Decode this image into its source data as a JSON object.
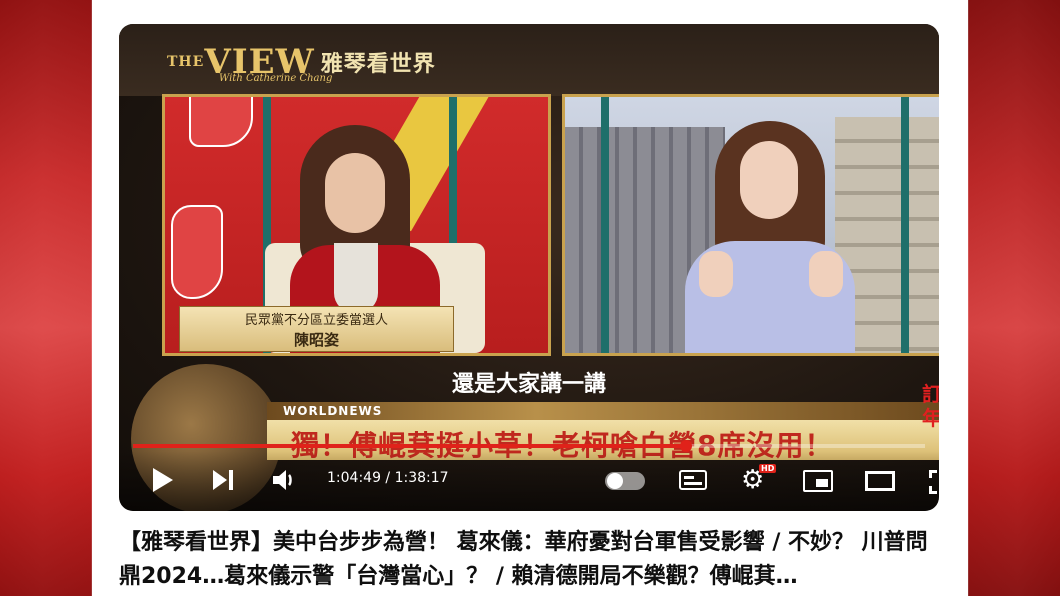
{
  "background": {
    "accent": "#c52222"
  },
  "show": {
    "logo_the": "THE",
    "logo_view": "VIEW",
    "logo_zh": "雅琴看世界",
    "logo_sub": "With Catherine Chang"
  },
  "guest": {
    "role": "民眾黨不分區立委當選人",
    "name": "陳昭姿"
  },
  "subtitle": "還是大家講一講",
  "news_label": "WORLDNEWS",
  "headline": "獨！傅崐萁挺小草！老柯嗆白營8席沒用！",
  "channel_logo": "訂閱\n年代",
  "player": {
    "progress": 0.698,
    "current_time": "1:04:49",
    "duration": "1:38:17",
    "time_display": "1:04:49 / 1:38:17",
    "hd_badge": "HD",
    "icons": [
      "play-icon",
      "next-icon",
      "volume-icon",
      "autoplay-toggle",
      "subtitles-icon",
      "settings-gear-icon",
      "miniplayer-icon",
      "theater-mode-icon",
      "fullscreen-icon"
    ],
    "accent": "#e0221a"
  },
  "video_title": "【雅琴看世界】美中台步步為營！ 葛來儀：華府憂對台軍售受影響 / 不妙？ 川普問鼎2024…葛來儀示警「台灣當心」？ / 賴清德開局不樂觀？傅崐萁…"
}
